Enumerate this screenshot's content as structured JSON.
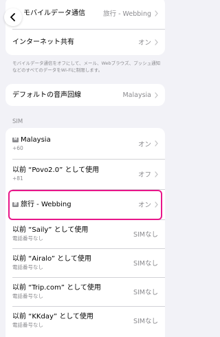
{
  "top_group": {
    "rows": [
      {
        "label": "モバイルデータ通信",
        "value": "旅行 - Webbing"
      },
      {
        "label": "インターネット共有",
        "value": "オン"
      }
    ]
  },
  "footnote": "モバイルデータ通信をオフにして、メール、Webブラウズ、プッシュ通知などのすべてのデータをWi-Fiに制限します。",
  "voice": {
    "label": "デフォルトの音声回線",
    "value": "Malaysia"
  },
  "sim_section": {
    "header": "SIM",
    "rows": [
      {
        "badge": "M",
        "label": "Malaysia",
        "sub": "+60",
        "value": "オン"
      },
      {
        "label": "以前 “Povo2.0” として使用",
        "sub": "+81",
        "value": "オフ"
      },
      {
        "badge": "旅",
        "label": "旅行 - Webbing",
        "value": "オン"
      },
      {
        "label": "以前 “Saily” として使用",
        "sub": "電話番号なし",
        "value": "SIMなし"
      },
      {
        "label": "以前 “Airalo” として使用",
        "sub": "電話番号なし",
        "value": "SIMなし"
      },
      {
        "label": "以前 “Trip.com” として使用",
        "sub": "電話番号なし",
        "value": "SIMなし"
      },
      {
        "label": "以前 “KKday” として使用",
        "sub": "電話番号なし",
        "value": "SIMなし"
      }
    ]
  },
  "colors": {
    "highlight": "#e8168a",
    "secondary_text": "#8a8a8e",
    "background": "#f2f2f7"
  },
  "icons": {
    "back": "chevron-left-icon",
    "disclosure": "chevron-right-icon"
  }
}
